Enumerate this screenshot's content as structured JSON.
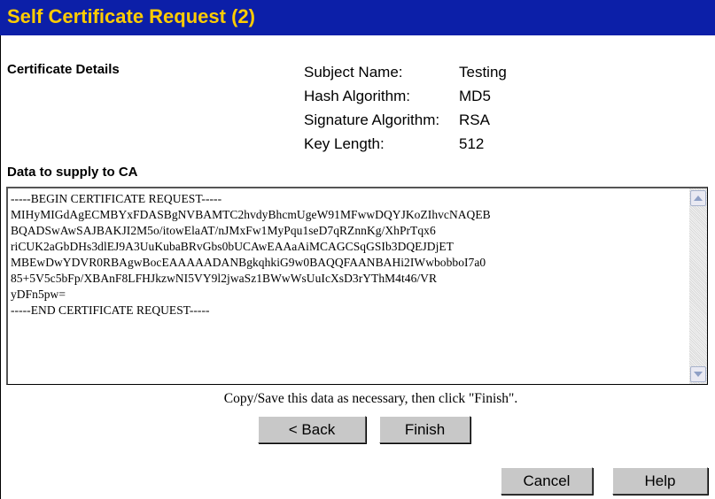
{
  "title": "Self Certificate Request (2)",
  "details": {
    "section_label": "Certificate Details",
    "rows": [
      {
        "key": "Subject Name:",
        "value": "Testing"
      },
      {
        "key": "Hash Algorithm:",
        "value": "MD5"
      },
      {
        "key": "Signature Algorithm:",
        "value": "RSA"
      },
      {
        "key": "Key Length:",
        "value": "512"
      }
    ]
  },
  "csr": {
    "section_label": "Data to supply to CA",
    "text": "-----BEGIN CERTIFICATE REQUEST-----\nMIHyMIGdAgECMBYxFDASBgNVBAMTC2hvdyBhcmUgeW91MFwwDQYJKoZIhvcNAQEB\nBQADSwAwSAJBAKJI2M5o/itowElaAT/nJMxFw1MyPqu1seD7qRZnnKg/XhPrTqx6\nriCUK2aGbDHs3dlEJ9A3UuKubaBRvGbs0bUCAwEAAaAiMCAGCSqGSIb3DQEJDjET\nMBEwDwYDVR0RBAgwBocEAAAAADANBgkqhkiG9w0BAQQFAANBAHi2IWwbobboI7a0\n85+5V5c5bFp/XBAnF8LFHJkzwNI5VY9l2jwaSz1BWwWsUuIcXsD3rYThM4t46/VR\nyDFn5pw=\n-----END CERTIFICATE REQUEST-----"
  },
  "instruction": "Copy/Save this data as necessary, then click \"Finish\".",
  "buttons": {
    "back": "< Back",
    "finish": "Finish",
    "cancel": "Cancel",
    "help": "Help"
  },
  "colors": {
    "title_bg": "#0c1fa8",
    "title_fg": "#ffcc00",
    "button_bg": "#c8c8c8"
  }
}
